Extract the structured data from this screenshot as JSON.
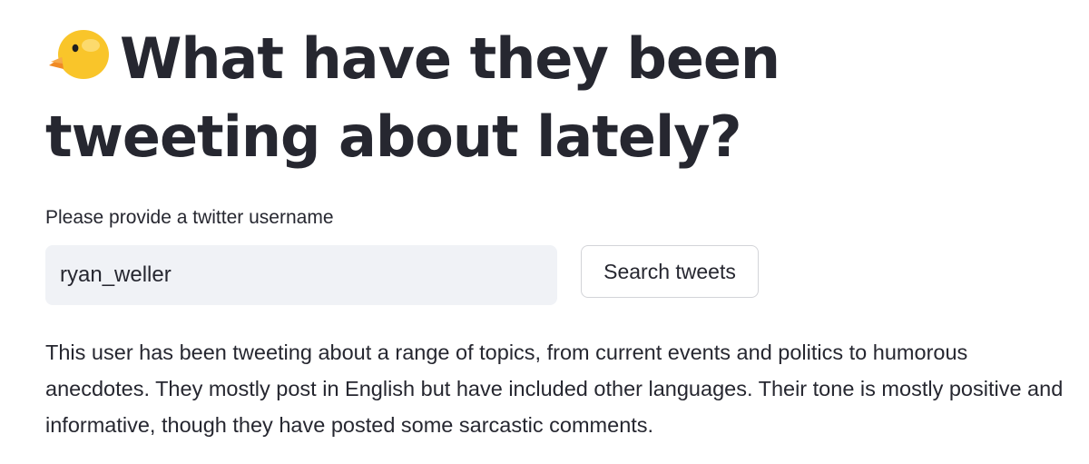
{
  "header": {
    "icon": "chick-icon",
    "title": "What have they been tweeting about lately?"
  },
  "form": {
    "label": "Please provide a twitter username",
    "username_value": "ryan_weller",
    "search_button_label": "Search tweets"
  },
  "result": {
    "summary": "This user has been tweeting about a range of topics, from current events and politics to humorous anecdotes. They mostly post in English but have included other languages. Their tone is mostly positive and informative, though they have posted some sarcastic comments."
  },
  "colors": {
    "text": "#262730",
    "input_background": "#f0f2f6",
    "button_border": "#d3d4d8",
    "chick_yellow": "#f9c52a",
    "chick_beak": "#f08a24"
  }
}
